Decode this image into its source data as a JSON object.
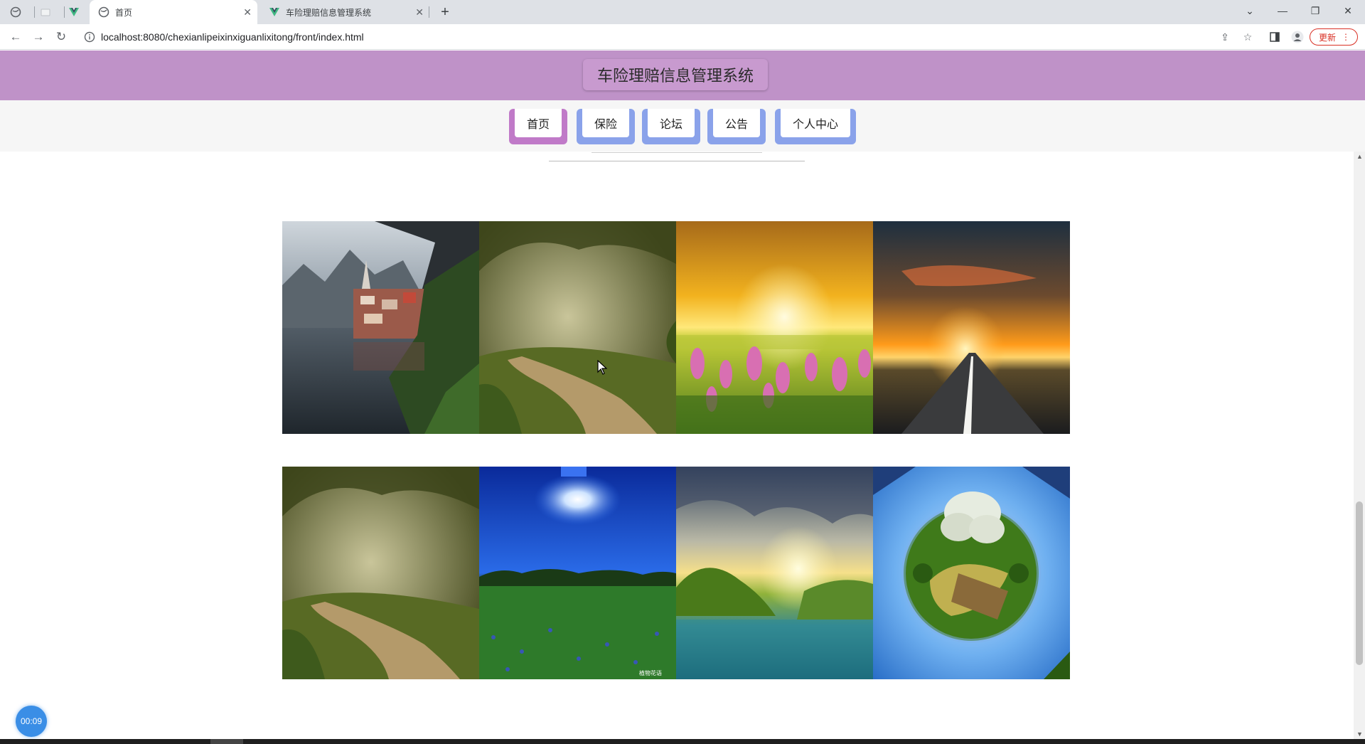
{
  "browser": {
    "tabs": [
      {
        "title": "",
        "icon": "globe-icon",
        "active": false
      },
      {
        "title": "",
        "icon": "blank-page-icon",
        "active": false
      },
      {
        "title": "",
        "icon": "vue-logo-icon",
        "active": false
      },
      {
        "title": "首页",
        "icon": "globe-icon",
        "active": true
      },
      {
        "title": "车险理赔信息管理系统",
        "icon": "vue-logo-icon",
        "active": false
      }
    ],
    "new_tab_symbol": "+",
    "url": "localhost:8080/chexianlipeixinxiguanlixitong/front/index.html",
    "update_label": "更新"
  },
  "site": {
    "title": "车险理赔信息管理系统",
    "nav": [
      "首页",
      "保险",
      "论坛",
      "公告",
      "个人中心"
    ],
    "colors": {
      "header": "#bf92c8",
      "nav_active": "#c07ac8",
      "nav_inactive": "#8aa2ea"
    }
  },
  "gallery": {
    "rows": [
      [
        "lake-village",
        "forest-path",
        "flower-sunset",
        "road-sunset"
      ],
      [
        "forest-path",
        "blue-sky-meadow",
        "valley-lake",
        "tiny-planet"
      ]
    ],
    "watermark": "植物花语"
  },
  "recorder": {
    "time": "00:09"
  }
}
